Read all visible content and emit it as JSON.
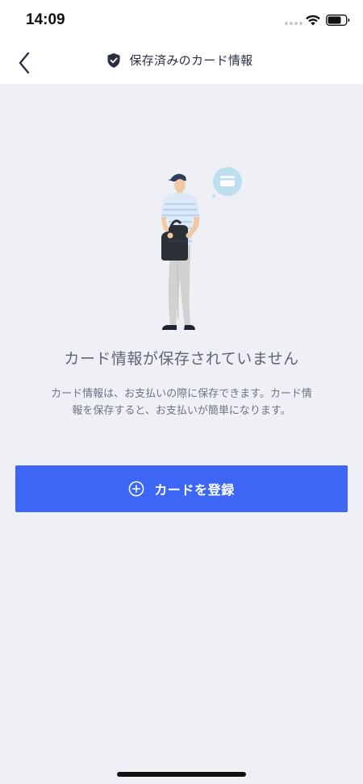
{
  "status_bar": {
    "time": "14:09"
  },
  "header": {
    "title": "保存済みのカード情報",
    "back_icon": "chevron-left-icon",
    "title_icon": "shield-check-icon"
  },
  "empty_state": {
    "illustration": "person-holding-bag-with-card-bubble",
    "title": "カード情報が保存されていません",
    "description_line1": "カード情報は、お支払いの際に保存できます。カード情",
    "description_line2": "報を保存すると、お支払いが簡単になります。"
  },
  "register_button": {
    "label": "カードを登録",
    "icon": "plus-circle-icon"
  },
  "colors": {
    "primary": "#3d66f5",
    "background": "#eff0f5",
    "title_text": "#2a3042"
  }
}
